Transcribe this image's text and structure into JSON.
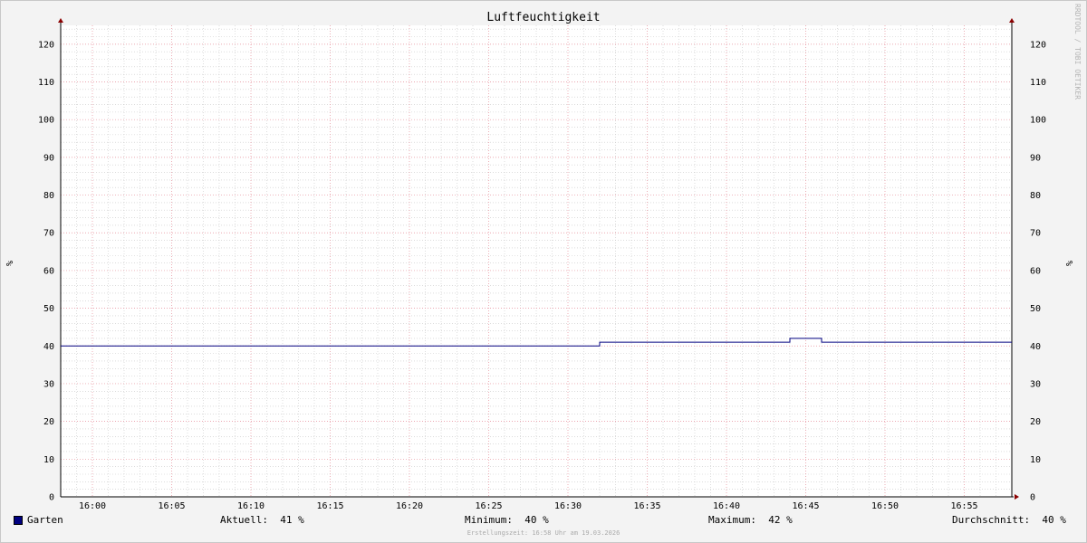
{
  "chart_data": {
    "type": "line",
    "title": "Luftfeuchtigkeit",
    "ylabel": "%",
    "ylabel_right": "%",
    "side_text": "RRDTOOL / TOBI OETIKER",
    "ylim": [
      0,
      125
    ],
    "yticks": [
      0,
      10,
      20,
      30,
      40,
      50,
      60,
      70,
      80,
      90,
      100,
      110,
      120
    ],
    "xlim": [
      "15:58",
      "16:58"
    ],
    "xticks": [
      "16:00",
      "16:05",
      "16:10",
      "16:15",
      "16:20",
      "16:25",
      "16:30",
      "16:35",
      "16:40",
      "16:45",
      "16:50",
      "16:55"
    ],
    "grid": true,
    "series": [
      {
        "name": "Garten",
        "color": "#000080",
        "points": [
          [
            "15:58",
            40
          ],
          [
            "16:32",
            40
          ],
          [
            "16:32",
            41
          ],
          [
            "16:44",
            41
          ],
          [
            "16:44",
            42
          ],
          [
            "16:46",
            42
          ],
          [
            "16:46",
            41
          ],
          [
            "16:58",
            41
          ]
        ]
      }
    ],
    "legend": {
      "name": "Garten",
      "current_label": "Aktuell:",
      "current_value": "41 %",
      "min_label": "Minimum:",
      "min_value": "40 %",
      "max_label": "Maximum:",
      "max_value": "42 %",
      "avg_label": "Durchschnitt:",
      "avg_value": "40 %"
    },
    "footer": "Erstellungszeit: 16:58 Uhr am 19.03.2026"
  }
}
